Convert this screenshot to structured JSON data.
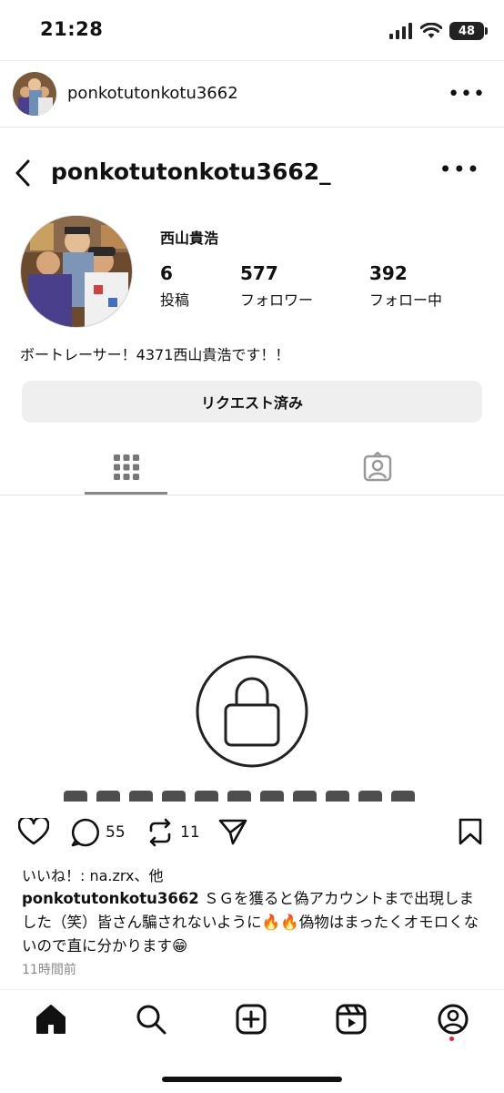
{
  "status_bar": {
    "time": "21:28",
    "battery": "48"
  },
  "post_header": {
    "username": "ponkotutonkotu3662",
    "more_icon": "more-horizontal-icon"
  },
  "profile": {
    "handle": "ponkotutonkotu3662_",
    "display_name": "西山貴浩",
    "stats": [
      {
        "value": "6",
        "label": "投稿"
      },
      {
        "value": "577",
        "label": "フォロワー"
      },
      {
        "value": "392",
        "label": "フォロー中"
      }
    ],
    "bio": "ボートレーサー！4371西山貴浩です！！",
    "request_button": "リクエスト済み"
  },
  "tabs": {
    "grid_icon": "grid-icon",
    "tagged_icon": "tagged-person-icon"
  },
  "actions": {
    "comments": "55",
    "reposts": "11"
  },
  "likes": "いいね！: na.zrx、他",
  "caption": {
    "username": "ponkotutonkotu3662",
    "text": " ＳＧを獲ると偽アカウントまで出現しました（笑）皆さん騙されないように🔥🔥偽物はまったくオモロくないので直に分かります😁"
  },
  "timestamp": "11時間前",
  "colors": {
    "accent_dot": "#e4243c",
    "button_bg": "#efefef"
  }
}
